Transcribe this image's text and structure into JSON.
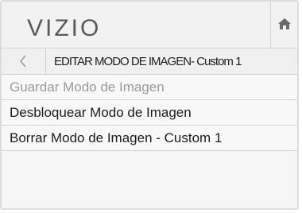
{
  "header": {
    "logo": "VIZIO",
    "home_icon": "home-icon"
  },
  "breadcrumb": {
    "back_icon": "back-arrow-icon",
    "title": "EDITAR MODO DE IMAGEN- Custom 1"
  },
  "menu": {
    "items": [
      {
        "label": "Guardar Modo de Imagen",
        "state": "disabled"
      },
      {
        "label": "Desbloquear Modo de Imagen",
        "state": "enabled"
      },
      {
        "label": "Borrar Modo de Imagen - Custom 1",
        "state": "enabled"
      }
    ]
  },
  "colors": {
    "panel_bg": "#f6f6f6",
    "text": "#1c1c1c",
    "disabled_text": "#9a9a9a",
    "logo": "#5a5a5a"
  }
}
